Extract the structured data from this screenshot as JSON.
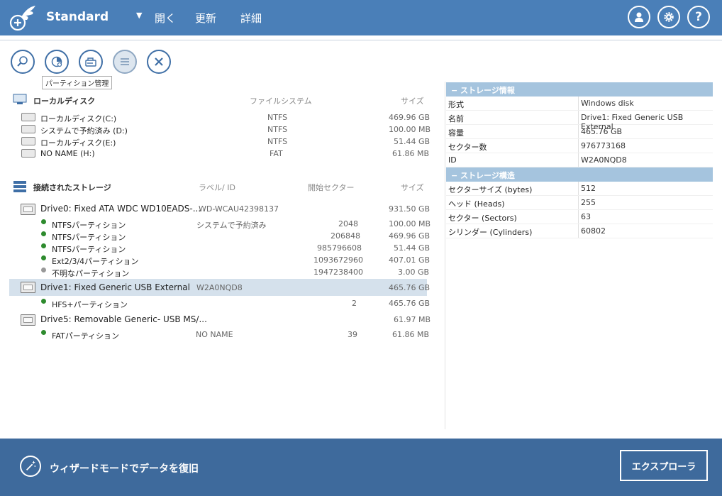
{
  "header": {
    "app_title": "Standard",
    "menu_caret": "▼",
    "menu": [
      "開く",
      "更新",
      "詳細"
    ],
    "profile_icon": "user-icon",
    "settings_icon": "gear-icon",
    "help_label": "?"
  },
  "toolbar": {
    "tools": [
      "search-icon",
      "partition-manager-icon",
      "image-icon",
      "list-icon",
      "close-icon"
    ],
    "tooltip": "パーティション管理"
  },
  "local_disks": {
    "title": "ローカルディスク",
    "col_fs": "ファイルシステム",
    "col_size": "サイズ",
    "items": [
      {
        "name": "ローカルディスク(C:)",
        "fs": "NTFS",
        "size": "469.96 GB"
      },
      {
        "name": "システムで予約済み (D:)",
        "fs": "NTFS",
        "size": "100.00 MB"
      },
      {
        "name": "ローカルディスク(E:)",
        "fs": "NTFS",
        "size": "51.44 GB"
      },
      {
        "name": "NO NAME (H:)",
        "fs": "FAT",
        "size": "61.86 MB"
      }
    ]
  },
  "storages": {
    "title": "接続されたストレージ",
    "col_label": "ラベル/ ID",
    "col_start": "開始セクター",
    "col_size": "サイズ",
    "drives": [
      {
        "name": "Drive0: Fixed ATA WDC WD10EADS-...",
        "id": "WD-WCAU42398137",
        "size": "931.50 GB",
        "partitions": [
          {
            "name": "NTFSパーティション",
            "label": "システムで予約済み",
            "start": "2048",
            "size": "100.00 MB",
            "status": "ok"
          },
          {
            "name": "NTFSパーティション",
            "label": "",
            "start": "206848",
            "size": "469.96 GB",
            "status": "ok"
          },
          {
            "name": "NTFSパーティション",
            "label": "",
            "start": "985796608",
            "size": "51.44 GB",
            "status": "ok"
          },
          {
            "name": "Ext2/3/4パーティション",
            "label": "",
            "start": "1093672960",
            "size": "407.01 GB",
            "status": "ok"
          },
          {
            "name": "不明なパーティション",
            "label": "",
            "start": "1947238400",
            "size": "3.00 GB",
            "status": "unknown"
          }
        ]
      },
      {
        "name": "Drive1: Fixed Generic USB External",
        "id": "W2A0NQD8",
        "size": "465.76 GB",
        "partitions": [
          {
            "name": "HFS+パーティション",
            "label": "",
            "start": "2",
            "size": "465.76 GB",
            "status": "ok"
          }
        ]
      },
      {
        "name": "Drive5: Removable Generic- USB MS/...",
        "id": "",
        "size": "61.97 MB",
        "partitions": [
          {
            "name": "FATパーティション",
            "label": "NO NAME",
            "start": "39",
            "size": "61.86 MB",
            "status": "ok"
          }
        ]
      }
    ]
  },
  "info": {
    "section1_title": "−  ストレージ情報",
    "props1": [
      {
        "k": "形式",
        "v": "Windows disk"
      },
      {
        "k": "名前",
        "v": "Drive1: Fixed Generic USB External"
      },
      {
        "k": "容量",
        "v": "465.76 GB"
      },
      {
        "k": "セクター数",
        "v": "976773168"
      },
      {
        "k": "ID",
        "v": "W2A0NQD8"
      }
    ],
    "section2_title": "−  ストレージ構造",
    "props2": [
      {
        "k": "セクターサイズ (bytes)",
        "v": "512"
      },
      {
        "k": "ヘッド (Heads)",
        "v": "255"
      },
      {
        "k": "セクター (Sectors)",
        "v": "63"
      },
      {
        "k": "シリンダー (Cylinders)",
        "v": "60802"
      }
    ]
  },
  "footer": {
    "wizard_label": "ウィザードモードでデータを復旧",
    "explorer_label": "エクスプローラ"
  }
}
